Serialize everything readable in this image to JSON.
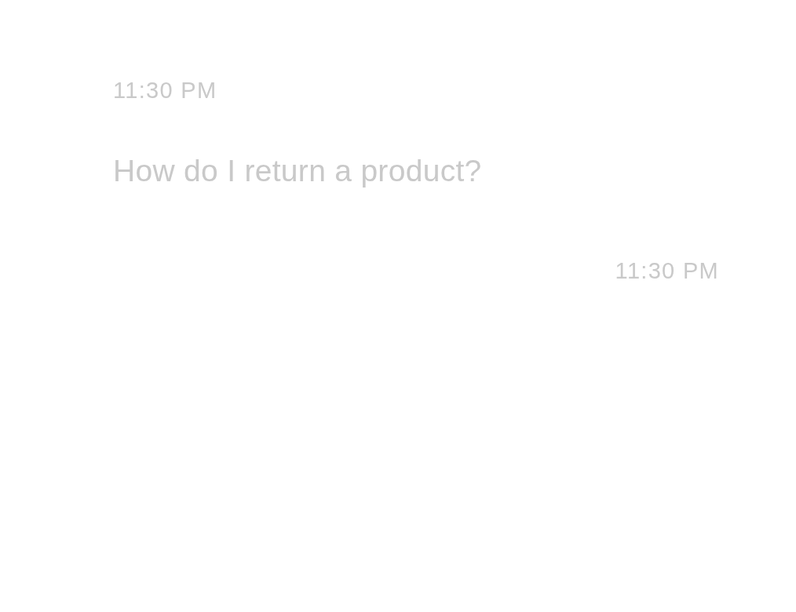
{
  "messages": [
    {
      "kind": "left",
      "time": "11:30 PM",
      "text": "How do I return a product?"
    },
    {
      "kind": "right",
      "time": "11:30 PM"
    }
  ]
}
